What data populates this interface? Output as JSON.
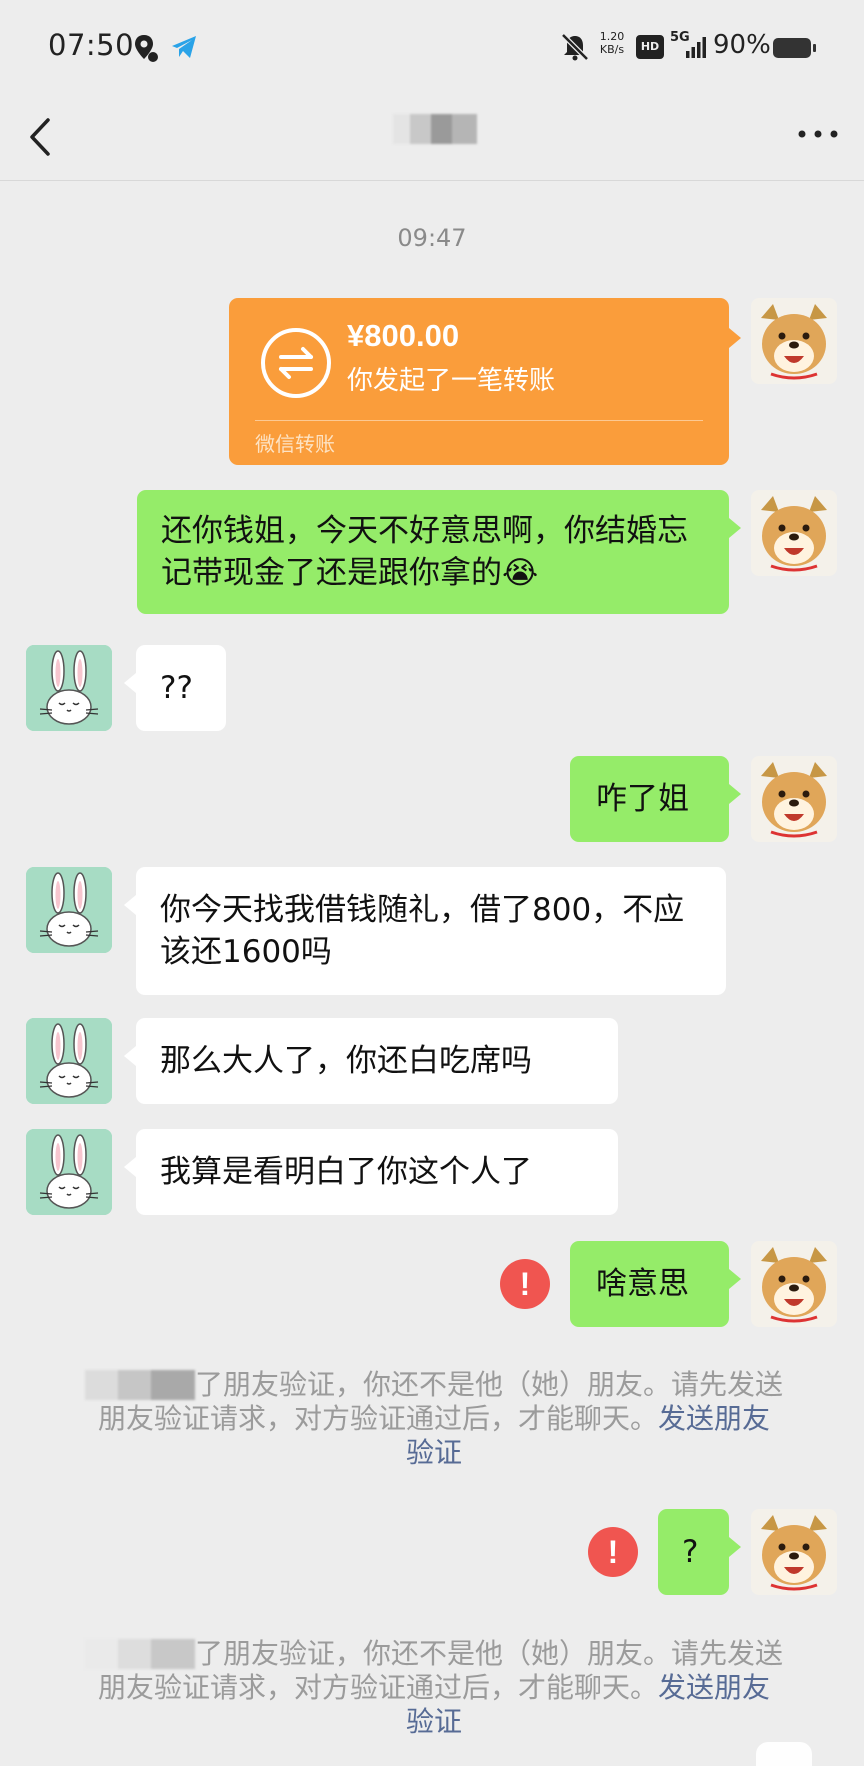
{
  "status_bar": {
    "time": "07:50",
    "net_speed_value": "1.20",
    "net_speed_unit": "KB/s",
    "hd": "HD",
    "network": "5G",
    "battery": "90%"
  },
  "nav": {
    "title": "",
    "back_icon": "chevron-left-icon",
    "more_icon": "more-dots-icon"
  },
  "chat": {
    "timestamp": "09:47",
    "transfer": {
      "amount": "¥800.00",
      "description": "你发起了一笔转账",
      "footer": "微信转账",
      "color": "#fa9d3b"
    },
    "messages": [
      {
        "sender": "me",
        "text": "还你钱姐，今天不好意思啊，你结婚忘记带现金了还是跟你拿的😭"
      },
      {
        "sender": "other",
        "text": "??"
      },
      {
        "sender": "me",
        "text": "咋了姐"
      },
      {
        "sender": "other",
        "text": "你今天找我借钱随礼，借了800，不应该还1600吗"
      },
      {
        "sender": "other",
        "text": "那么大人了，你还白吃席吗"
      },
      {
        "sender": "other",
        "text": "我算是看明白了你这个人了"
      },
      {
        "sender": "me",
        "text": "啥意思",
        "failed": true
      },
      {
        "sender": "me",
        "text": "?",
        "failed": true
      }
    ],
    "system_notice_1": {
      "text": "了朋友验证，你还不是他（她）朋友。请先发送朋友验证请求，对方验证通过后，才能聊天。",
      "link": "发送朋友验证"
    },
    "system_notice_2": {
      "text": "了朋友验证，你还不是他（她）朋友。请先发送朋友验证请求，对方验证通过后，才能聊天。",
      "link": "发送朋友验证"
    },
    "error_mark": "!",
    "bubble_green": "#95ec69",
    "bubble_white": "#ffffff",
    "link_color": "#576b95"
  }
}
